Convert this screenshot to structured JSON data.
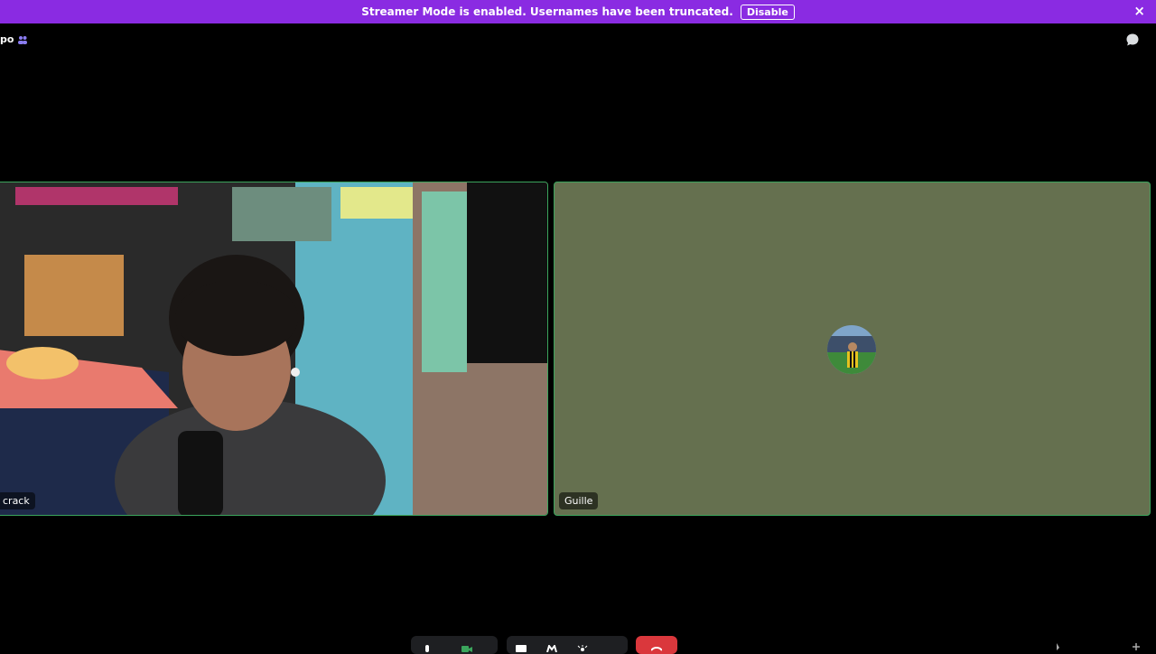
{
  "banner": {
    "text": "Streamer Mode is enabled. Usernames have been truncated.",
    "button_label": "Disable",
    "color": "#8a2be2"
  },
  "header": {
    "channel_name": "po",
    "people_icon": "people-icon",
    "chat_icon": "chat-bubble-icon"
  },
  "tiles": {
    "left": {
      "name": "crack",
      "content": "camera-video"
    },
    "right": {
      "name": "Guille",
      "background": "#65704f",
      "avatar": "user-avatar"
    }
  },
  "controls": {
    "icons": [
      "microphone-icon",
      "camera-icon",
      "screen-share-icon",
      "activity-icon",
      "soundboard-icon",
      "end-call-icon"
    ],
    "end_call_color": "#da373c"
  },
  "accent": "#3ba55c"
}
